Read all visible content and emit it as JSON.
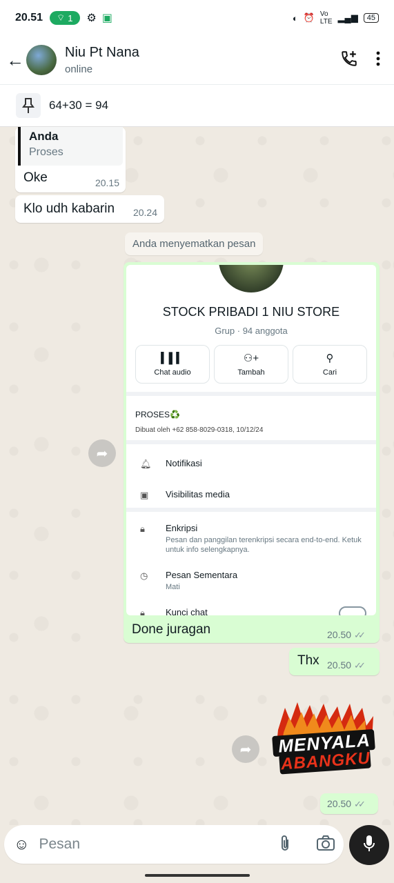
{
  "status_bar": {
    "time": "20.51",
    "hotspot_count": "1",
    "battery": "45"
  },
  "header": {
    "contact_name": "Niu Pt Nana",
    "presence": "online"
  },
  "pinned": {
    "text": "64+30 = 94"
  },
  "messages": {
    "reply_quote_name": "Anda",
    "reply_quote_text": "Proses",
    "oke_text": "Oke",
    "oke_time": "20.15",
    "klo_text": "Klo udh kabarin",
    "klo_time": "20.24",
    "system_text": "Anda menyematkan pesan",
    "done_text": "Done juragan",
    "done_time": "20.50",
    "thx_text": "Thx",
    "thx_time": "20.50",
    "sticker_time": "20.50"
  },
  "screenshot": {
    "group_name": "STOCK PRIBADI 1 NIU STORE",
    "group_sub": "Grup · 94 anggota",
    "actions": [
      "Chat audio",
      "Tambah",
      "Cari"
    ],
    "desc_title": "PROSES♻️",
    "desc_meta": "Dibuat oleh +62 858-8029-0318, 10/12/24",
    "notifikasi": "Notifikasi",
    "visibilitas": "Visibilitas media",
    "enkripsi": "Enkripsi",
    "enkripsi_sub": "Pesan dan panggilan terenkripsi secara end-to-end. Ketuk untuk info selengkapnya.",
    "pesan_sementara": "Pesan Sementara",
    "pesan_sementara_sub": "Mati",
    "kunci_chat": "Kunci chat"
  },
  "sticker": {
    "line1": "MENYALA",
    "line2": "ABANGKU"
  },
  "composer": {
    "placeholder": "Pesan"
  },
  "colors": {
    "outgoing": "#d9fdd3",
    "incoming": "#ffffff",
    "chat_bg": "#efeae2",
    "accent": "#1daa61"
  }
}
